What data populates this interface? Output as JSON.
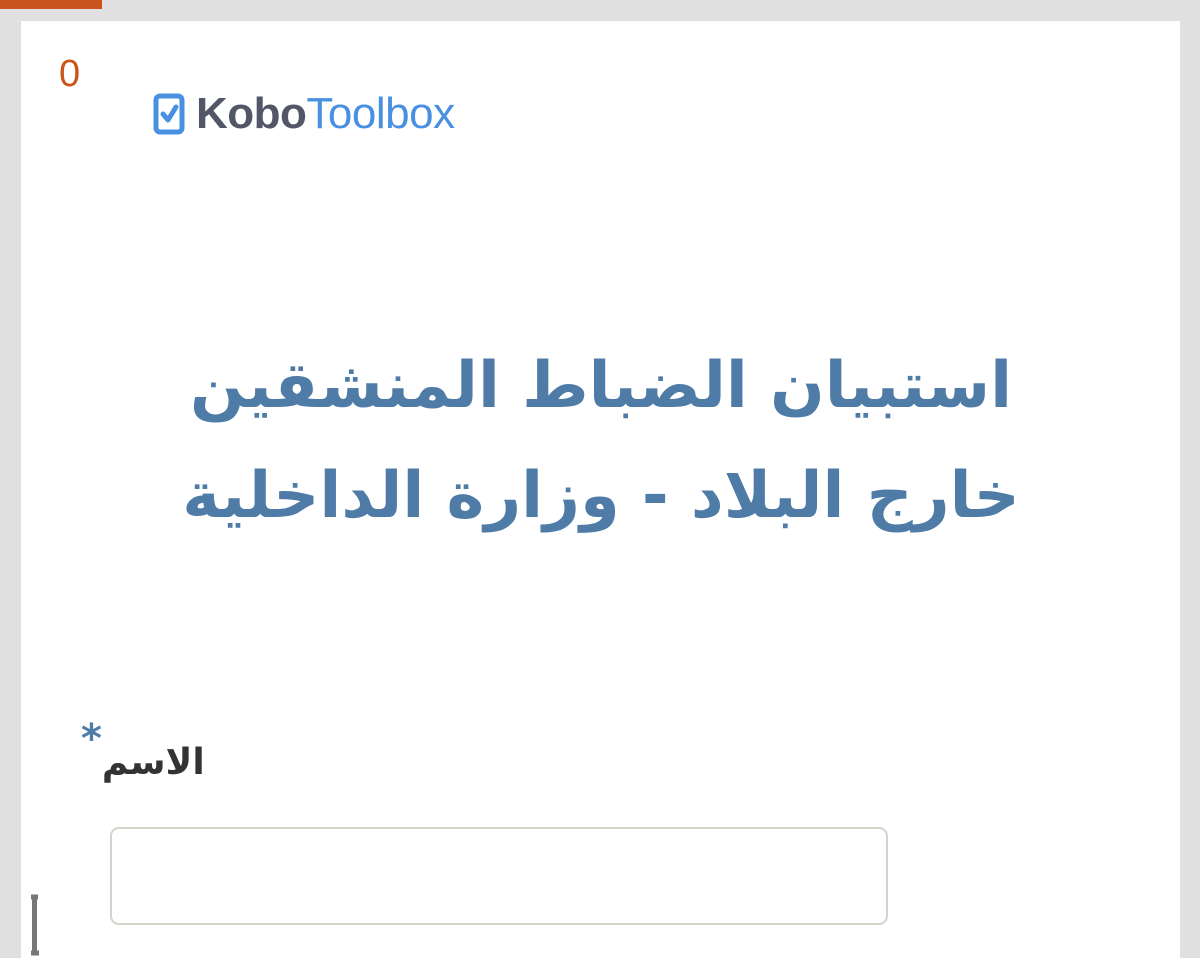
{
  "progress": {
    "percent": 8.5,
    "color": "#c9541c"
  },
  "header": {
    "counter": "0",
    "logo": {
      "part1": "Kobo",
      "part2": "Toolbox",
      "icon": "kobo-checkbox-icon"
    }
  },
  "form": {
    "title_line1": "استبيان الضباط المنشقين",
    "title_line2": "خارج البلاد - وزارة الداخلية",
    "title_color": "#4f7ba7"
  },
  "question": {
    "required_mark": "*",
    "label": "الاسم",
    "value": "",
    "placeholder": ""
  },
  "colors": {
    "background": "#e0e0e0",
    "card": "#ffffff",
    "accent": "#c9541c",
    "brand_blue": "#4a90e2",
    "brand_gray": "#525667"
  }
}
